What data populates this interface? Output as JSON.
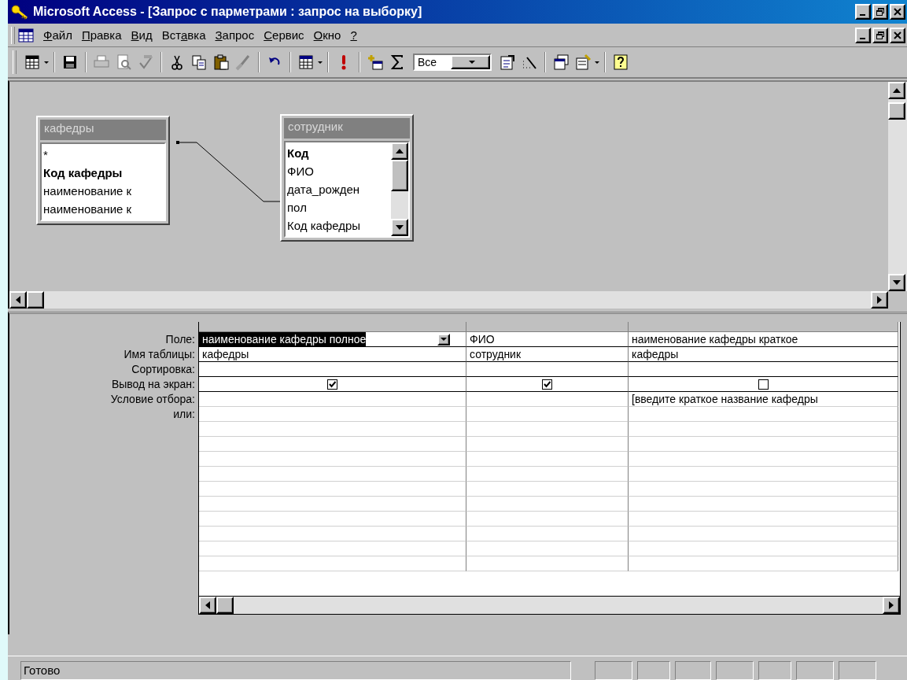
{
  "window": {
    "title": "Microsoft Access - [Запрос с парметрами : запрос на выборку]"
  },
  "menu": [
    {
      "key": "Ф",
      "after": "айл"
    },
    {
      "key": "П",
      "after": "равка"
    },
    {
      "key": "В",
      "after": "ид"
    },
    {
      "before": "Вст",
      "key": "а",
      "after": "вка"
    },
    {
      "key": "З",
      "after": "апрос"
    },
    {
      "key": "С",
      "after": "ервис"
    },
    {
      "key": "О",
      "after": "кно"
    },
    {
      "key": "?"
    }
  ],
  "toolbar": {
    "query_filter": "Все"
  },
  "tables": [
    {
      "title": "кафедры",
      "fields": [
        {
          "name": "*",
          "key": false
        },
        {
          "name": "Код кафедры",
          "key": true
        },
        {
          "name": "наименование к",
          "key": false
        },
        {
          "name": "наименование к",
          "key": false
        }
      ],
      "scrollable": false
    },
    {
      "title": "сотрудник",
      "fields": [
        {
          "name": "Код",
          "key": true
        },
        {
          "name": "ФИО",
          "key": false
        },
        {
          "name": "дата_рожден",
          "key": false
        },
        {
          "name": "пол",
          "key": false
        },
        {
          "name": "Код кафедры",
          "key": false
        }
      ],
      "scrollable": true
    }
  ],
  "grid": {
    "row_labels": [
      "Поле:",
      "Имя таблицы:",
      "Сортировка:",
      "Вывод на экран:",
      "Условие отбора:",
      "или:"
    ],
    "columns": [
      {
        "field": "наименование кафедры полное",
        "table": "кафедры",
        "show": true,
        "selected": true
      },
      {
        "field": "ФИО",
        "table": "сотрудник",
        "show": true,
        "selected": false
      },
      {
        "field": "наименование кафедры краткое",
        "table": "кафедры",
        "show": false,
        "selected": false,
        "criteria": "[введите краткое название кафедры"
      }
    ]
  },
  "status_bar": {
    "text": "Готово"
  }
}
